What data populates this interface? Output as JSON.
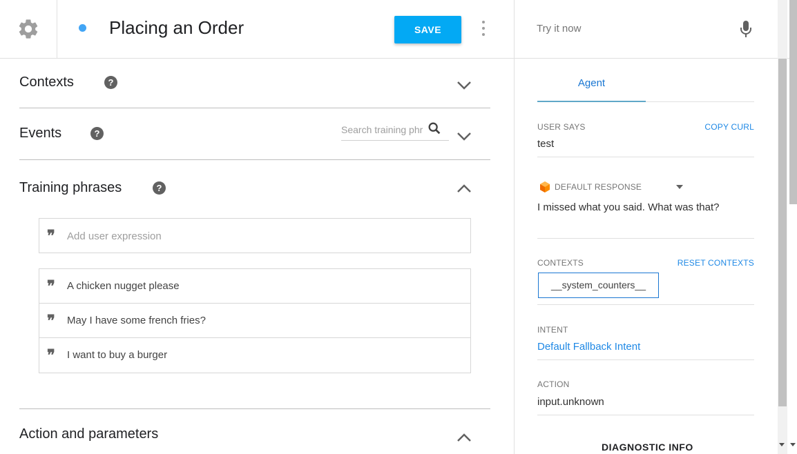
{
  "header": {
    "title": "Placing an Order",
    "save_label": "SAVE",
    "status_color": "#42a5f5"
  },
  "sections": {
    "contexts_label": "Contexts",
    "events_label": "Events",
    "training_label": "Training phrases",
    "action_label": "Action and parameters",
    "help_glyph": "?"
  },
  "training": {
    "search_placeholder": "Search training phrases",
    "add_placeholder": "Add user expression",
    "quote_glyph": "❞",
    "phrases": [
      "A chicken nugget please",
      "May I have some french fries?",
      "I want to buy a burger"
    ]
  },
  "try_panel": {
    "placeholder": "Try it now",
    "tab_label": "Agent",
    "user_says_label": "USER SAYS",
    "copy_curl_label": "COPY CURL",
    "user_says_value": "test",
    "default_response_label": "DEFAULT RESPONSE",
    "default_response_value": "I missed what you said. What was that?",
    "contexts_label": "CONTEXTS",
    "reset_contexts_label": "RESET CONTEXTS",
    "context_chip": "__system_counters__",
    "intent_label": "INTENT",
    "intent_value": "Default Fallback Intent",
    "action_label": "ACTION",
    "action_value": "input.unknown",
    "diagnostic_label": "DIAGNOSTIC INFO"
  },
  "colors": {
    "accent": "#03a9f4",
    "link": "#1e88e5",
    "cube": "#f57c00"
  }
}
